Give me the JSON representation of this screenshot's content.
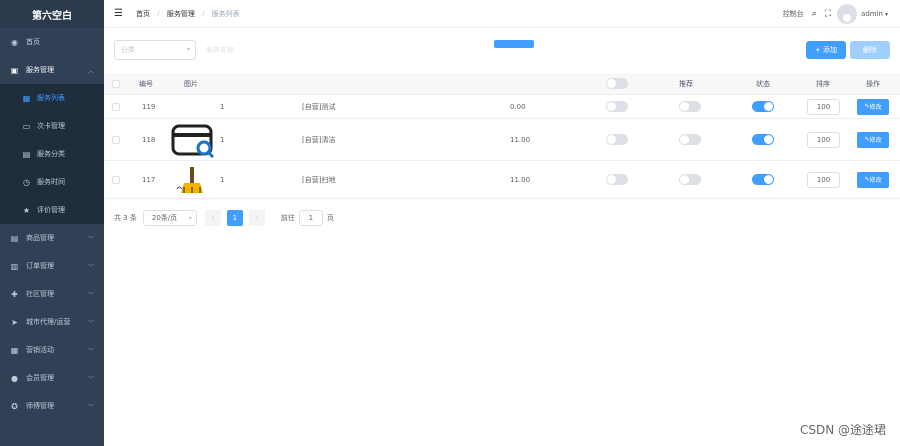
{
  "sidebar": {
    "logo": "第六空白",
    "items": [
      {
        "label": "首页",
        "icon": "◉"
      },
      {
        "label": "服务管理",
        "icon": "▣",
        "open": true
      },
      {
        "label": "商品管理",
        "icon": "▤"
      },
      {
        "label": "订单管理",
        "icon": "▥"
      },
      {
        "label": "社区管理",
        "icon": "✚"
      },
      {
        "label": "城市代理/运营",
        "icon": "➤"
      },
      {
        "label": "营销活动",
        "icon": "▦"
      },
      {
        "label": "会员管理",
        "icon": "●"
      },
      {
        "label": "师傅管理",
        "icon": "✪"
      }
    ],
    "subitems": [
      {
        "label": "服务列表",
        "icon": "▦",
        "active": true
      },
      {
        "label": "次卡管理",
        "icon": "▭"
      },
      {
        "label": "服务分类",
        "icon": "▤"
      },
      {
        "label": "服务时间",
        "icon": "◷"
      },
      {
        "label": "评价管理",
        "icon": "★"
      }
    ]
  },
  "navbar": {
    "breadcrumb": [
      "首页",
      "服务管理",
      "服务列表"
    ],
    "console": "控制台",
    "user": "admin"
  },
  "filters": {
    "category_placeholder": "分类",
    "input_placeholder": "服务名称",
    "add_button": "+ 添加",
    "delete_button": "删除"
  },
  "table": {
    "headers": {
      "id": "编号",
      "image": "图片",
      "recommend": "推荐",
      "status": "状态",
      "sort": "排序",
      "action": "操作"
    },
    "rows": [
      {
        "id": "119",
        "num": "1",
        "name": "[自营]测试",
        "price": "0.00",
        "sort": "100",
        "status_on": true,
        "edit": "修改"
      },
      {
        "id": "118",
        "num": "1",
        "name": "[自营]清洁",
        "price": "11.00",
        "sort": "100",
        "status_on": true,
        "edit": "修改"
      },
      {
        "id": "117",
        "num": "1",
        "name": "[自营]扫地",
        "price": "11.00",
        "sort": "100",
        "status_on": true,
        "edit": "修改"
      }
    ]
  },
  "pagination": {
    "total": "共 3 条",
    "page_size": "20条/页",
    "current_page": "1",
    "goto_prefix": "前往",
    "goto_value": "1",
    "goto_suffix": "页"
  },
  "watermark": "CSDN @途途珺",
  "colors": {
    "primary": "#409eff",
    "sidebar": "#304156"
  }
}
